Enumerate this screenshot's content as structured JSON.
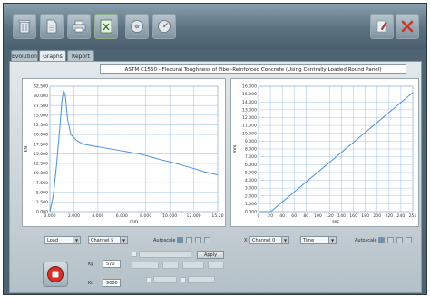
{
  "tabs": [
    {
      "label": "Evolution"
    },
    {
      "label": "Graphs"
    },
    {
      "label": "Report"
    }
  ],
  "title": "ASTM C1550 - Flexural Toughness of Fiber-Reinforced Concrete (Using Centrally Loaded Round Panel)",
  "toolbar": {
    "icons": [
      "trash-icon",
      "document-icon",
      "printer-icon",
      "spreadsheet-icon",
      "disc-icon",
      "gauge-icon",
      "edit-icon",
      "close-icon"
    ],
    "accent": "#c0392b"
  },
  "chart_data": [
    {
      "type": "line",
      "ylabel": "kN",
      "xlabel": "mm",
      "x_ticks": [
        "0.000",
        "2.000",
        "4.000",
        "6.000",
        "8.000",
        "10.000",
        "12.000",
        "15.20"
      ],
      "y_ticks": [
        "0.000",
        "2.500",
        "5.000",
        "7.500",
        "10.000",
        "12.500",
        "15.000",
        "17.500",
        "20.000",
        "22.500",
        "25.000",
        "27.500",
        "30.000",
        "32.500"
      ],
      "xlim": [
        0,
        15.2
      ],
      "ylim": [
        0,
        32.5
      ],
      "grid": true,
      "series": [
        {
          "color": "#4a90d9",
          "points": [
            [
              0,
              0
            ],
            [
              0.3,
              4
            ],
            [
              0.6,
              12
            ],
            [
              0.9,
              22
            ],
            [
              1.1,
              29
            ],
            [
              1.25,
              31.5
            ],
            [
              1.4,
              30
            ],
            [
              1.6,
              24
            ],
            [
              1.9,
              20
            ],
            [
              2.4,
              18.5
            ],
            [
              3,
              17.5
            ],
            [
              4,
              17
            ],
            [
              5,
              16.5
            ],
            [
              6,
              16
            ],
            [
              7,
              15.5
            ],
            [
              8,
              15
            ],
            [
              9,
              14.3
            ],
            [
              10,
              13.5
            ],
            [
              11,
              12.8
            ],
            [
              12,
              12
            ],
            [
              13,
              11.2
            ],
            [
              14,
              10.3
            ],
            [
              15.2,
              9.5
            ]
          ]
        }
      ]
    },
    {
      "type": "line",
      "ylabel": "mm",
      "xlabel": "sec",
      "x_ticks": [
        "0",
        "20",
        "40",
        "60",
        "80",
        "100",
        "120",
        "140",
        "160",
        "180",
        "200",
        "220",
        "240",
        "251"
      ],
      "y_ticks": [
        "0.000",
        "1.000",
        "2.000",
        "3.000",
        "4.000",
        "5.000",
        "6.000",
        "7.000",
        "8.000",
        "9.000",
        "10.000",
        "11.000",
        "12.000",
        "13.000",
        "14.000",
        "15.000",
        "16.000"
      ],
      "xlim": [
        0,
        251
      ],
      "ylim": [
        0,
        16
      ],
      "grid": true,
      "series": [
        {
          "color": "#4a90d9",
          "points": [
            [
              0,
              0
            ],
            [
              20,
              0
            ],
            [
              251,
              15.2
            ]
          ]
        }
      ]
    }
  ],
  "controls": {
    "left_select": "Load",
    "left_channel": "Channel 5",
    "left_autoscale": "Autoscale",
    "right_x": "X",
    "right_channel": "Channel 0",
    "right_select": "Time",
    "right_autoscale": "Autoscale"
  },
  "bottom": {
    "kp_label": "Kp",
    "kp_value": "570",
    "ki_label": "Ki",
    "ki_value": "9000",
    "apply_label": "Apply"
  }
}
